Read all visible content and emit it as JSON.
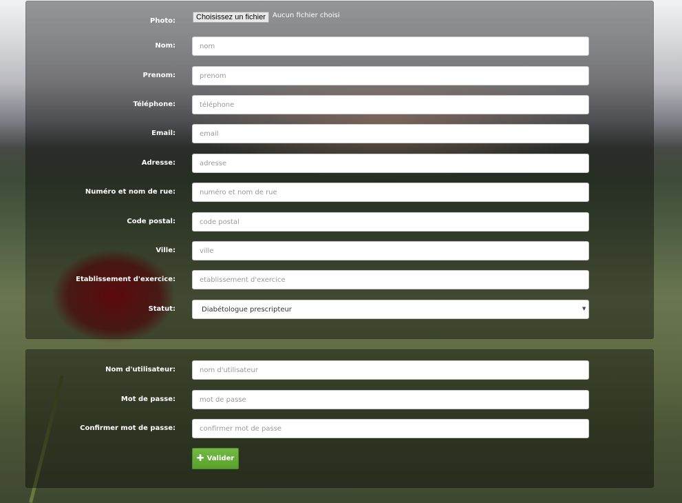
{
  "profile": {
    "photo_label": "Photo:",
    "photo_button": "Choisissez un fichier",
    "photo_status": "Aucun fichier choisi",
    "fields": [
      {
        "label": "Nom:",
        "placeholder": "nom"
      },
      {
        "label": "Prenom:",
        "placeholder": "prenom"
      },
      {
        "label": "Téléphone:",
        "placeholder": "téléphone"
      },
      {
        "label": "Email:",
        "placeholder": "email"
      },
      {
        "label": "Adresse:",
        "placeholder": "adresse"
      },
      {
        "label": "Numéro et nom de rue:",
        "placeholder": "numéro et nom de rue"
      },
      {
        "label": "Code postal:",
        "placeholder": "code postal"
      },
      {
        "label": "Ville:",
        "placeholder": "ville"
      },
      {
        "label": "Etablissement d'exercice:",
        "placeholder": "etablissement d'exercice"
      }
    ],
    "statut_label": "Statut:",
    "statut_value": "Diabétologue prescripteur"
  },
  "account": {
    "fields": [
      {
        "label": "Nom d'utilisateur:",
        "placeholder": "nom d'utilisateur"
      },
      {
        "label": "Mot de passe:",
        "placeholder": "mot de passe"
      },
      {
        "label": "Confirmer mot de passe:",
        "placeholder": "confirmer mot de passe"
      }
    ],
    "submit_label": "Valider"
  }
}
